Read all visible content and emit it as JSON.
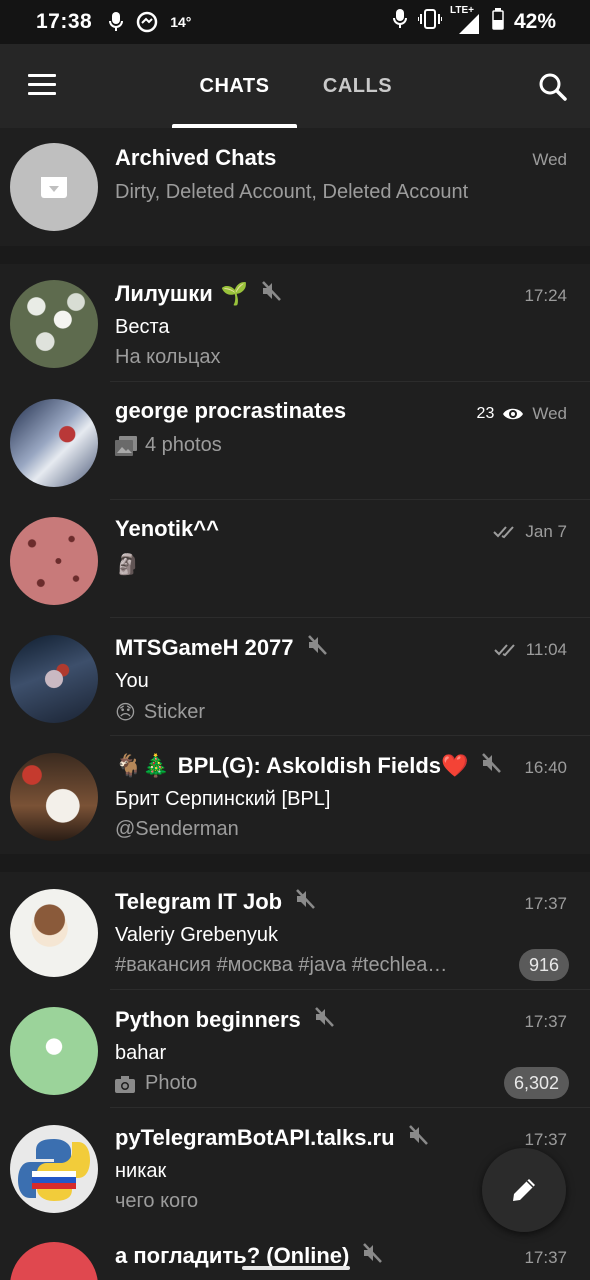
{
  "status_bar": {
    "time": "17:38",
    "temperature": "14°",
    "network": "LTE+",
    "battery": "42%",
    "icons": [
      "microphone-icon",
      "messenger-icon",
      "microphone-icon",
      "vibrate-icon",
      "signal-icon",
      "battery-icon"
    ]
  },
  "header": {
    "tabs": [
      {
        "label": "CHATS",
        "active": true
      },
      {
        "label": "CALLS",
        "active": false
      }
    ],
    "icons": [
      "menu-icon",
      "search-icon"
    ]
  },
  "archived": {
    "name": "Archived Chats",
    "preview": "Dirty, Deleted Account, Deleted Account",
    "time": "Wed"
  },
  "chats": [
    {
      "name": "Лилушки",
      "name_emoji": "🌱",
      "muted": true,
      "line2": "Веста",
      "line3": "На кольцах",
      "time": "17:24"
    },
    {
      "name": "george procrastinates",
      "views": "23",
      "line2": "4 photos",
      "time": "Wed",
      "preview_icon": "photos-icon"
    },
    {
      "name": "Yenotik^^",
      "line2": "🗿",
      "time": "Jan 7",
      "read": true
    },
    {
      "name": "MTSGameH 2077",
      "muted": true,
      "line2": "You",
      "line3_emoji": "😞",
      "line3": "Sticker",
      "time": "11:04",
      "read": true
    },
    {
      "name_prefix": "🐐🎄",
      "name": "BPL(G): Askoldish Fields",
      "name_emoji": "❤️",
      "muted": true,
      "line2": "Брит Серпинский [BPL]",
      "line3": "@Senderman",
      "time": "16:40"
    },
    {
      "name": "Telegram IT Job",
      "muted": true,
      "line2": "Valeriy Grebenyuk",
      "line3": "#вакансия #москва #java #techlea…",
      "time": "17:37",
      "badge": "916"
    },
    {
      "name": "Python beginners",
      "muted": true,
      "line2": "bahar",
      "line3": "Photo",
      "time": "17:37",
      "badge": "6,302",
      "preview_icon": "camera-icon"
    },
    {
      "name": "pyTelegramBotAPI.talks.ru",
      "muted": true,
      "line2": "никак",
      "line3": "чего кого",
      "time": "17:37"
    },
    {
      "name": "а погладить? (Online)",
      "muted": true,
      "time": "17:37"
    }
  ],
  "fab": {
    "icon": "pencil-icon"
  },
  "colors": {
    "background": "#1a1a1a",
    "header": "#262626",
    "text_secondary": "#9c9c9c",
    "badge": "#5a5a5a"
  }
}
